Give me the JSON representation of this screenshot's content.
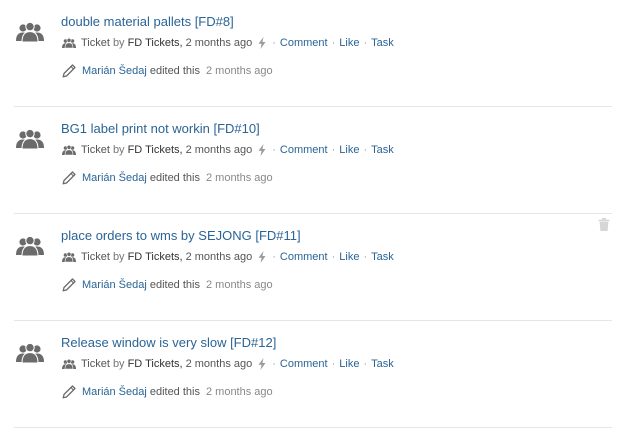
{
  "feed": {
    "items": [
      {
        "title": "double material pallets [FD#8]",
        "type": "Ticket",
        "by": "by",
        "author": "FD Tickets,",
        "time": "2 months ago",
        "comment": "Comment",
        "like": "Like",
        "task": "Task",
        "editor": "Marián Šedaj",
        "action": "edited this",
        "edited_ago": "2 months ago"
      },
      {
        "title": "BG1 label print not workin [FD#10]",
        "type": "Ticket",
        "by": "by",
        "author": "FD Tickets,",
        "time": "2 months ago",
        "comment": "Comment",
        "like": "Like",
        "task": "Task",
        "editor": "Marián Šedaj",
        "action": "edited this",
        "edited_ago": "2 months ago"
      },
      {
        "title": "place orders to wms by SEJONG [FD#11]",
        "type": "Ticket",
        "by": "by",
        "author": "FD Tickets,",
        "time": "2 months ago",
        "comment": "Comment",
        "like": "Like",
        "task": "Task",
        "editor": "Marián Šedaj",
        "action": "edited this",
        "edited_ago": "2 months ago"
      },
      {
        "title": "Release window is very slow [FD#12]",
        "type": "Ticket",
        "by": "by",
        "author": "FD Tickets,",
        "time": "2 months ago",
        "comment": "Comment",
        "like": "Like",
        "task": "Task",
        "editor": "Marián Šedaj",
        "action": "edited this",
        "edited_ago": "2 months ago"
      }
    ],
    "separator": "·",
    "icons": {
      "avatar": "people-group-icon",
      "type": "small-people-icon",
      "bolt": "lightning-bolt-icon",
      "edit": "pencil-icon",
      "delete": "trash-icon"
    },
    "colors": {
      "link": "#2a6496",
      "icon": "#6b6b6b",
      "divider": "#e6e6e6",
      "trash": "#d6d6d6"
    }
  }
}
